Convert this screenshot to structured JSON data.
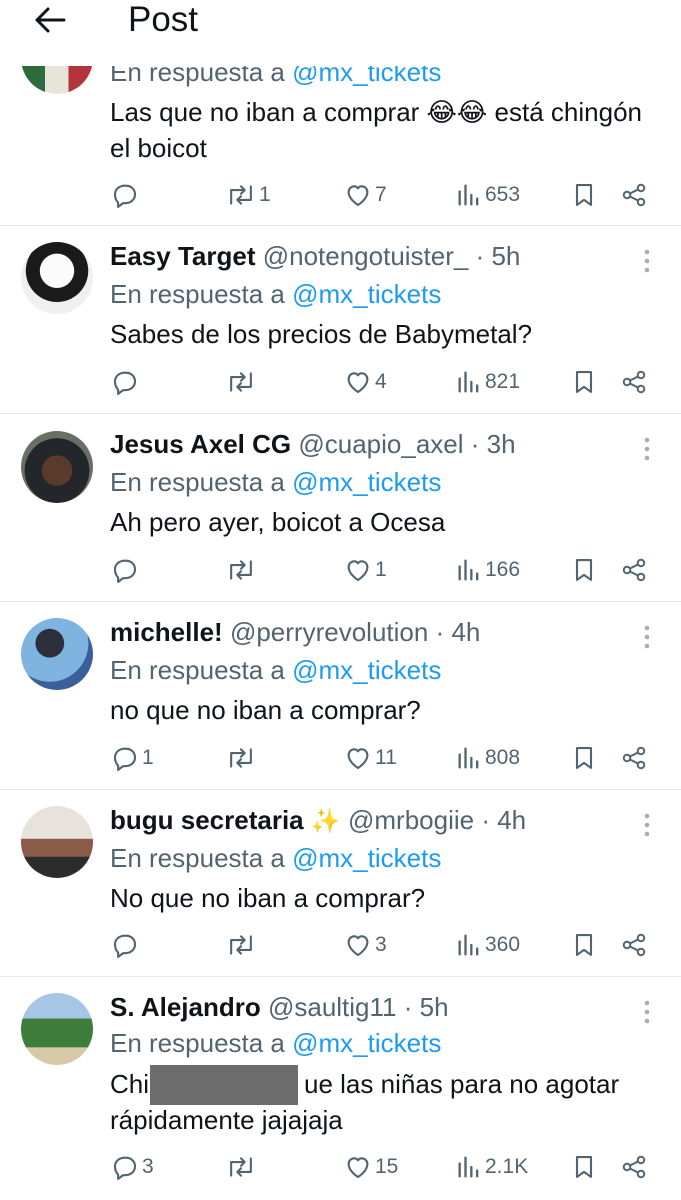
{
  "header": {
    "title": "Post"
  },
  "first_reply": {
    "reply_prefix": "En respuesta a",
    "reply_mention": "@mx_tickets",
    "text_before": "Las que no iban a comprar",
    "emoji": "😂😂",
    "text_after": "está chingón",
    "text_line2": "el boicot",
    "stats": {
      "replies": "",
      "reposts": "1",
      "likes": "7",
      "views": "653"
    }
  },
  "replies": [
    {
      "name": "Easy Target",
      "handle": "@notengotuister_",
      "time": "· 5h",
      "reply_prefix": "En respuesta a",
      "reply_mention": "@mx_tickets",
      "text": "Sabes de los precios de Babymetal?",
      "stats": {
        "replies": "",
        "reposts": "",
        "likes": "4",
        "views": "821"
      }
    },
    {
      "name": "Jesus Axel CG",
      "handle": "@cuapio_axel",
      "time": "· 3h",
      "reply_prefix": "En respuesta a",
      "reply_mention": "@mx_tickets",
      "text": "Ah pero ayer, boicot a Ocesa",
      "stats": {
        "replies": "",
        "reposts": "",
        "likes": "1",
        "views": "166"
      }
    },
    {
      "name": "michelle!",
      "handle": "@perryrevolution",
      "time": "· 4h",
      "reply_prefix": "En respuesta a",
      "reply_mention": "@mx_tickets",
      "text": "no que no iban a comprar?",
      "stats": {
        "replies": "1",
        "reposts": "",
        "likes": "11",
        "views": "808"
      }
    },
    {
      "name": "bugu secretaria",
      "name_emoji": "✨",
      "handle": "@mrbogiie",
      "time": "· 4h",
      "reply_prefix": "En respuesta a",
      "reply_mention": "@mx_tickets",
      "text": "No que no iban a comprar?",
      "stats": {
        "replies": "",
        "reposts": "",
        "likes": "3",
        "views": "360"
      }
    },
    {
      "name": "S. Alejandro",
      "handle": "@saultig11",
      "time": "· 5h",
      "reply_prefix": "En respuesta a",
      "reply_mention": "@mx_tickets",
      "text_start": "Chi",
      "text_end": "ue las niñas para no agotar",
      "text_line2": "rápidamente jajajaja",
      "stats": {
        "replies": "3",
        "reposts": "",
        "likes": "15",
        "views": "2.1K"
      }
    }
  ],
  "colors": {
    "text": "#0f1419",
    "secondary": "#536471",
    "link": "#1d9bf0",
    "divider": "#e6e9eb"
  }
}
